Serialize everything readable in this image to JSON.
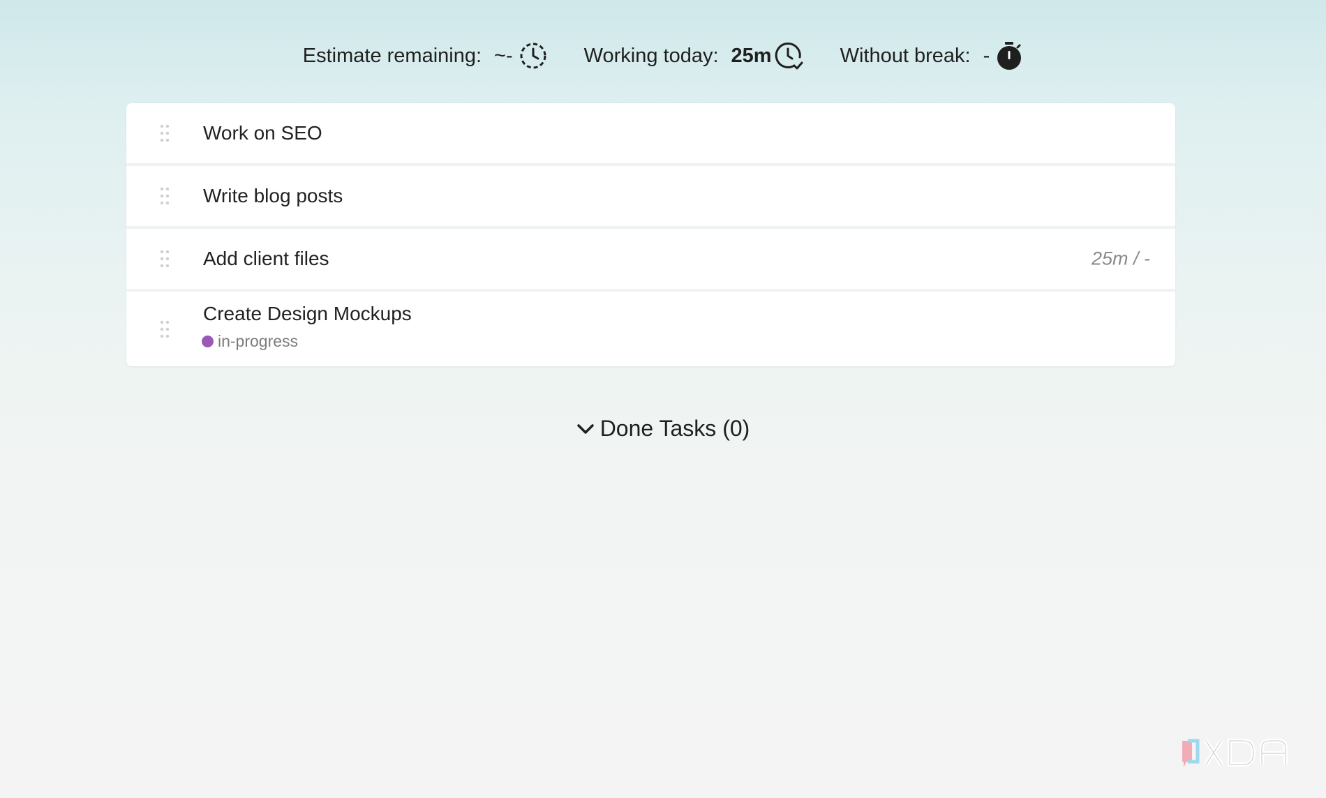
{
  "metrics": {
    "estimate_label": "Estimate remaining:",
    "estimate_value": "~-",
    "estimate_icon": "dashed-clock-icon",
    "working_label": "Working today:",
    "working_value": "25m",
    "working_icon": "clock-check-icon",
    "break_label": "Without break:",
    "break_value": "-",
    "break_icon": "stopwatch-icon"
  },
  "tasks": [
    {
      "title": "Work on SEO"
    },
    {
      "title": "Write blog posts"
    },
    {
      "title": "Add client files",
      "time": "25m / -"
    },
    {
      "title": "Create Design Mockups",
      "tag": "in-progress",
      "tag_color": "#9b59b6"
    }
  ],
  "done_tasks": {
    "label": "Done Tasks (0)",
    "icon": "chevron-down-icon"
  },
  "watermark": {
    "text": "XDA"
  }
}
